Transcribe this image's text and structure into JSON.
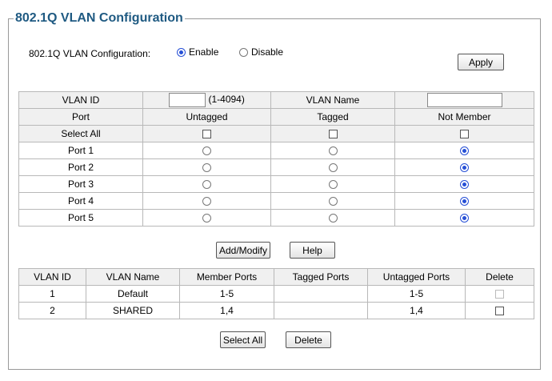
{
  "title": "802.1Q VLAN Configuration",
  "config": {
    "label": "802.1Q VLAN Configuration:",
    "enable_label": "Enable",
    "disable_label": "Disable",
    "selected": "Enable",
    "apply_label": "Apply"
  },
  "form": {
    "vlan_id_label": "VLAN ID",
    "vlan_id_value": "",
    "vlan_id_range": "(1-4094)",
    "vlan_name_label": "VLAN Name",
    "vlan_name_value": "",
    "headers": {
      "port": "Port",
      "untagged": "Untagged",
      "tagged": "Tagged",
      "not_member": "Not Member"
    },
    "select_all_label": "Select All",
    "ports": [
      {
        "name": "Port 1",
        "membership": "Not Member"
      },
      {
        "name": "Port 2",
        "membership": "Not Member"
      },
      {
        "name": "Port 3",
        "membership": "Not Member"
      },
      {
        "name": "Port 4",
        "membership": "Not Member"
      },
      {
        "name": "Port 5",
        "membership": "Not Member"
      }
    ],
    "add_modify_label": "Add/Modify",
    "help_label": "Help"
  },
  "vlan_table": {
    "columns": [
      "VLAN ID",
      "VLAN Name",
      "Member Ports",
      "Tagged Ports",
      "Untagged Ports",
      "Delete"
    ],
    "rows": [
      {
        "id": "1",
        "name": "Default",
        "member": "1-5",
        "tagged": "",
        "untagged": "1-5",
        "delete_disabled": true
      },
      {
        "id": "2",
        "name": "SHARED",
        "member": "1,4",
        "tagged": "",
        "untagged": "1,4",
        "delete_disabled": false
      }
    ],
    "select_all_label": "Select All",
    "delete_label": "Delete"
  },
  "colors": {
    "title": "#1f5a82",
    "radio_accent": "#2750d6",
    "header_bg": "#f0f0f0"
  }
}
